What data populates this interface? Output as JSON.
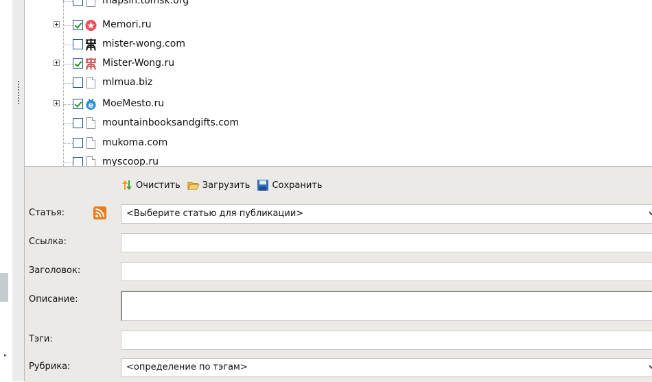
{
  "tree": {
    "items": [
      {
        "label": "mapsin.tomsk.org",
        "checked": false,
        "expandable": false,
        "icon": "document-icon"
      },
      {
        "label": "Memori.ru",
        "checked": true,
        "expandable": true,
        "icon": "memori-logo-icon"
      },
      {
        "label": "mister-wong.com",
        "checked": false,
        "expandable": false,
        "icon": "mister-wong-logo-icon"
      },
      {
        "label": "Mister-Wong.ru",
        "checked": true,
        "expandable": true,
        "icon": "mister-wong-logo-icon"
      },
      {
        "label": "mlmua.biz",
        "checked": false,
        "expandable": false,
        "icon": "document-icon"
      },
      {
        "label": "MoeMesto.ru",
        "checked": true,
        "expandable": true,
        "icon": "moemesto-logo-icon"
      },
      {
        "label": "mountainbooksandgifts.com",
        "checked": false,
        "expandable": false,
        "icon": "document-icon"
      },
      {
        "label": "mukoma.com",
        "checked": false,
        "expandable": false,
        "icon": "document-icon"
      },
      {
        "label": "myscoop.ru",
        "checked": false,
        "expandable": false,
        "icon": "document-icon"
      }
    ]
  },
  "toolbar": {
    "clear_label": "Очистить",
    "load_label": "Загрузить",
    "save_label": "Сохранить"
  },
  "form": {
    "article_label": "Статья:",
    "article_value": "<Выберите статью для публикации>",
    "link_label": "Ссылка:",
    "link_value": "",
    "title_label": "Заголовок:",
    "title_value": "",
    "description_label": "Описание:",
    "description_value": "",
    "tags_label": "Тэги:",
    "tags_value": "",
    "category_label": "Рубрика:",
    "category_value": "<определение по тэгам>"
  },
  "colors": {
    "panel_bg": "#ebeae6",
    "checkbox_border": "#1c5180",
    "check_mark": "#1e9a1e",
    "rss_orange": "#e87a24"
  }
}
